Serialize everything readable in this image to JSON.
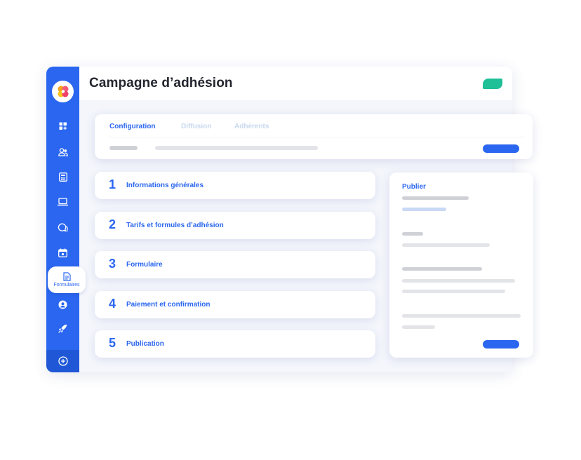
{
  "app": {
    "title": "Campagne d’adhésion"
  },
  "sidebar": {
    "items": [
      {
        "name": "dashboard",
        "icon": "dashboard-icon"
      },
      {
        "name": "members",
        "icon": "users-icon"
      },
      {
        "name": "accounting",
        "icon": "calculator-icon"
      },
      {
        "name": "website",
        "icon": "laptop-icon"
      },
      {
        "name": "messages",
        "icon": "chat-icon"
      },
      {
        "name": "events",
        "icon": "calendar-icon"
      },
      {
        "name": "forms",
        "icon": "document-icon",
        "label": "Formulaires",
        "active": true
      },
      {
        "name": "contacts",
        "icon": "contact-icon"
      },
      {
        "name": "launch",
        "icon": "rocket-icon"
      }
    ],
    "footer_icon": "plus-circle-icon"
  },
  "tabs": [
    {
      "label": "Configuration",
      "active": true
    },
    {
      "label": "Diffusion",
      "active": false
    },
    {
      "label": "Adhérents",
      "active": false
    }
  ],
  "steps": [
    {
      "number": "1",
      "label": "Informations générales"
    },
    {
      "number": "2",
      "label": "Tarifs et formules d’adhésion"
    },
    {
      "number": "3",
      "label": "Formulaire"
    },
    {
      "number": "4",
      "label": "Paiement et confirmation"
    },
    {
      "number": "5",
      "label": "Publication"
    }
  ],
  "publish_panel": {
    "title": "Publier"
  },
  "colors": {
    "primary": "#2a66f0",
    "accent": "#1fbf98",
    "title_text": "#23252e",
    "inactive_tab": "#c8d8ee",
    "placeholder": "#d7d9df"
  }
}
